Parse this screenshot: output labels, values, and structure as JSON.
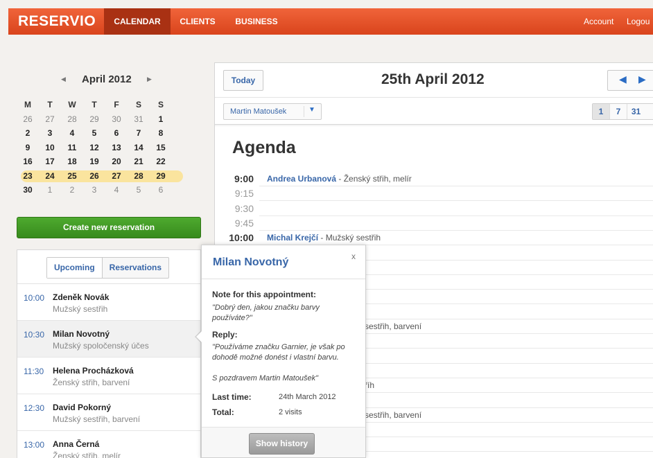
{
  "app": {
    "logo": "RESERVIO",
    "nav": [
      "CALENDAR",
      "CLIENTS",
      "BUSINESS"
    ],
    "account": "Account",
    "logout": "Logou",
    "accent": "#e7512a"
  },
  "mini_calendar": {
    "title": "April 2012",
    "weekdays": [
      "M",
      "T",
      "W",
      "T",
      "F",
      "S",
      "S"
    ],
    "weeks": [
      [
        "26",
        "27",
        "28",
        "29",
        "30",
        "31",
        "1"
      ],
      [
        "2",
        "3",
        "4",
        "5",
        "6",
        "7",
        "8"
      ],
      [
        "9",
        "10",
        "11",
        "12",
        "13",
        "14",
        "15"
      ],
      [
        "16",
        "17",
        "18",
        "19",
        "20",
        "21",
        "22"
      ],
      [
        "23",
        "24",
        "25",
        "26",
        "27",
        "28",
        "29"
      ],
      [
        "30",
        "1",
        "2",
        "3",
        "4",
        "5",
        "6"
      ]
    ],
    "highlight_color": "#fae49e"
  },
  "create_button": "Create new reservation",
  "upcoming": {
    "tabs": [
      "Upcoming",
      "Reservations"
    ],
    "items": [
      {
        "time": "10:00",
        "name": "Zdeněk Novák",
        "service": "Mužský sestřih"
      },
      {
        "time": "10:30",
        "name": "Milan Novotný",
        "service": "Mužský spoločenský účes"
      },
      {
        "time": "11:30",
        "name": "Helena Procházková",
        "service": "Ženský střih, barvení"
      },
      {
        "time": "12:30",
        "name": "David Pokorný",
        "service": "Mužský sestřih, barvení"
      },
      {
        "time": "13:00",
        "name": "Anna Černá",
        "service": "Ženský střih, melír"
      }
    ]
  },
  "main": {
    "today_label": "Today",
    "date": "25th April 2012",
    "staff": "Martin Matoušek",
    "views": [
      "1",
      "7",
      "31"
    ],
    "agenda_title": "Agenda",
    "slots": [
      {
        "time": "9:00",
        "client": "Andrea Urbanová",
        "service": " - Ženský střih, melír"
      },
      {
        "time": "9:15"
      },
      {
        "time": "9:30"
      },
      {
        "time": "9:45"
      },
      {
        "time": "10:00",
        "client": "Michal Krejčí",
        "service": " - Mužský sestřih"
      },
      {
        "time": ""
      },
      {
        "time": ""
      },
      {
        "time": ""
      },
      {
        "time": ""
      },
      {
        "time": ""
      },
      {
        "time": "",
        "service": "sestřih, barvení"
      },
      {
        "time": ""
      },
      {
        "time": ""
      },
      {
        "time": ""
      },
      {
        "time": "",
        "service": "říh"
      },
      {
        "time": ""
      },
      {
        "time": "",
        "service": "sestřih, barvení"
      },
      {
        "time": ""
      },
      {
        "time": ""
      },
      {
        "time": ""
      }
    ]
  },
  "popup": {
    "title": "Milan Novotný",
    "close": "x",
    "note_label": "Note for this appointment:",
    "note": "\"Dobrý den, jakou značku barvy používáte?\"",
    "reply_label": "Reply:",
    "reply": "\"Používáme značku Garnier, je však po dohodě možné donést i vlastní barvu.",
    "reply_sign": "S pozdravem Martin Matoušek\"",
    "last_time_label": "Last time:",
    "last_time": "24th March 2012",
    "total_label": "Total:",
    "total": "2 visits",
    "button": "Show history"
  }
}
